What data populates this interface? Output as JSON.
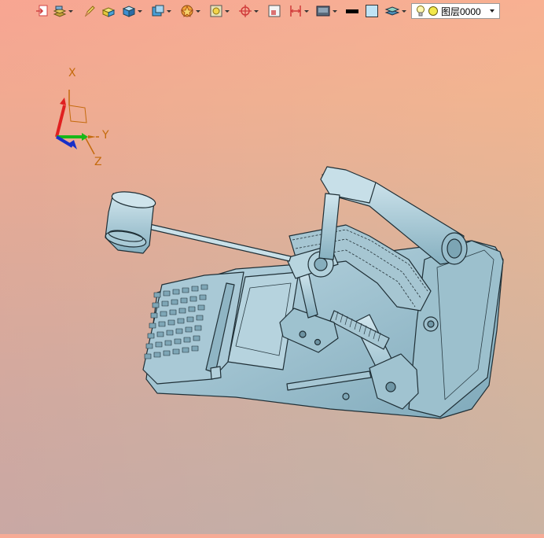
{
  "toolbar": {
    "items": [
      {
        "icon": "import-icon",
        "dropdown": false
      },
      {
        "icon": "layer-stack-icon",
        "dropdown": true
      },
      {
        "icon": "pencil-icon",
        "dropdown": false
      },
      {
        "icon": "material-icon",
        "dropdown": false
      },
      {
        "icon": "solid-cube-icon",
        "dropdown": true
      },
      {
        "icon": "view-cube-icon",
        "dropdown": true
      },
      {
        "icon": "sketch-star-icon",
        "dropdown": true
      },
      {
        "icon": "render-box-icon",
        "dropdown": true
      },
      {
        "icon": "crosshair-icon",
        "dropdown": true
      },
      {
        "icon": "frame-icon",
        "dropdown": false
      },
      {
        "icon": "dimension-icon",
        "dropdown": true
      },
      {
        "icon": "display-mode-icon",
        "dropdown": true
      },
      {
        "icon": "line-color-icon",
        "dropdown": false
      },
      {
        "icon": "fill-color-icon",
        "dropdown": false
      },
      {
        "icon": "layers-icon",
        "dropdown": true
      }
    ],
    "layer": {
      "name": "图层0000",
      "visible": true,
      "color": "#f2e84a"
    }
  },
  "axis": {
    "x": "X",
    "y": "Y",
    "z": "Z"
  },
  "model": {
    "color": "#9fc3d1",
    "outline": "#1f2f36",
    "name": "drum-pedal-assembly"
  }
}
